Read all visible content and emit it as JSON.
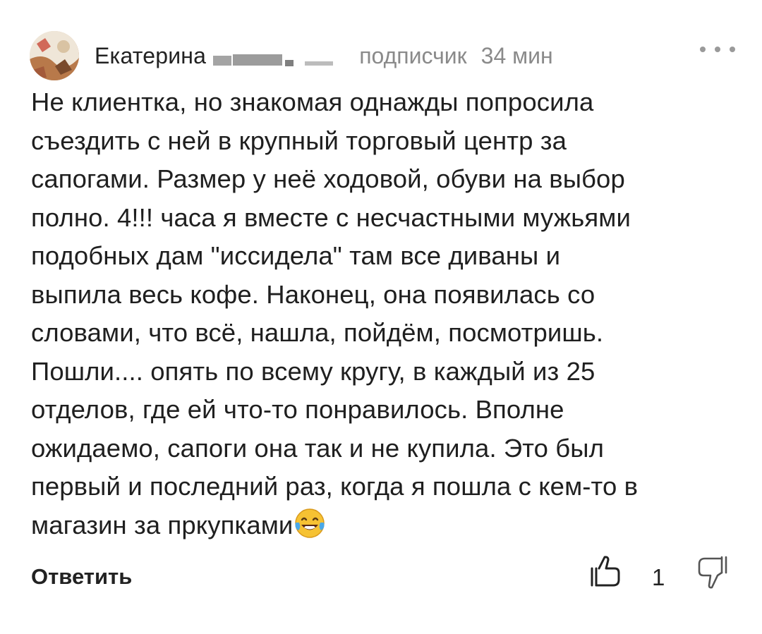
{
  "comment": {
    "author": {
      "name": "Екатерина",
      "role": "подписчик",
      "time": "34 мин"
    },
    "text_lines": [
      "Не клиентка, но знакомая однажды попросила",
      "съездить с ней в крупный торговый центр за",
      "сапогами. Размер у неё ходовой, обуви на выбор",
      "полно. 4!!! часа я вместе с несчастными мужьями",
      "подобных дам \"иссидела\" там все диваны и",
      "выпила весь кофе. Наконец, она появилась со",
      "словами, что всё, нашла, пойдём, посмотришь.",
      "Пошли.... опять по всему кругу, в каждый из 25",
      "отделов, где ей что-то понравилось. Вполне",
      "ожидаемо, сапоги она так и не купила. Это был",
      "первый и последний раз, когда я пошла с кем-то в",
      "магазин за пркупками"
    ],
    "emoji": "laughing-with-tears",
    "actions": {
      "reply_label": "Ответить",
      "like_count": "1"
    }
  }
}
